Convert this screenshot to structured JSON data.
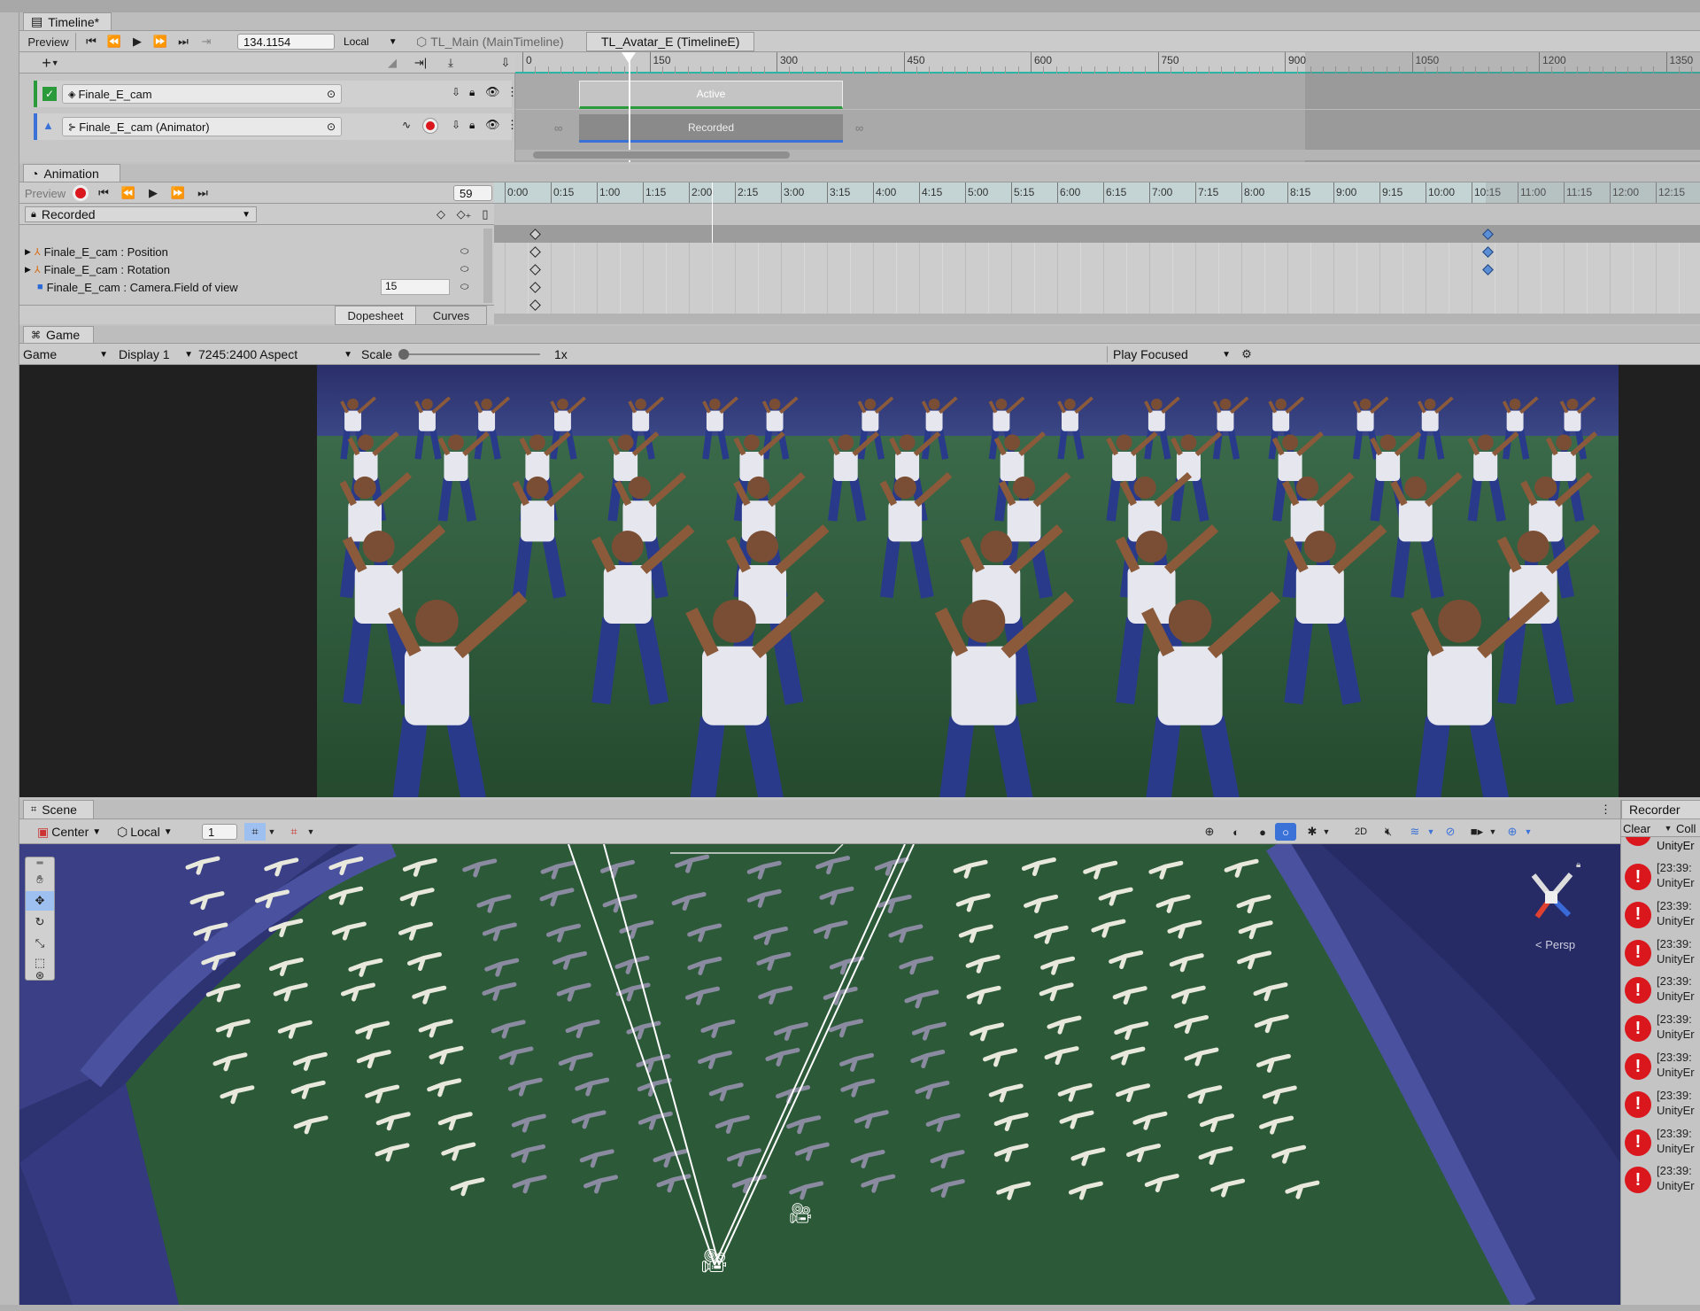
{
  "timeline": {
    "tab_title": "Timeline*",
    "preview_label": "Preview",
    "time_value": "134.1154",
    "local_label": "Local",
    "breadcrumbs": [
      "TL_Main (MainTimeline)",
      "TL_Avatar_E (TimelineE)"
    ],
    "ruler_labels": [
      "0",
      "150",
      "300",
      "450",
      "600",
      "750",
      "900",
      "1050",
      "1200",
      "1350"
    ],
    "tracks": [
      {
        "name": "Finale_E_cam",
        "clip": "Active"
      },
      {
        "name": "Finale_E_cam (Animator)",
        "clip": "Recorded"
      }
    ]
  },
  "animation": {
    "tab_title": "Animation",
    "preview_label": "Preview",
    "frame_value": "59",
    "clip_dropdown": "Recorded",
    "ruler_labels": [
      "0:00",
      "0:15",
      "1:00",
      "1:15",
      "2:00",
      "2:15",
      "3:00",
      "3:15",
      "4:00",
      "4:15",
      "5:00",
      "5:15",
      "6:00",
      "6:15",
      "7:00",
      "7:15",
      "8:00",
      "8:15",
      "9:00",
      "9:15",
      "10:00",
      "10:15",
      "11:00",
      "11:15",
      "12:00",
      "12:15"
    ],
    "properties": [
      {
        "label": "Finale_E_cam : Position",
        "value": ""
      },
      {
        "label": "Finale_E_cam : Rotation",
        "value": ""
      },
      {
        "label": "Finale_E_cam : Camera.Field of view",
        "value": "15"
      }
    ],
    "view_tabs": [
      "Dopesheet",
      "Curves"
    ]
  },
  "game": {
    "tab_title": "Game",
    "mode_dropdown": "Game",
    "display_dropdown": "Display 1",
    "aspect_dropdown": "7245:2400 Aspect",
    "scale_label": "Scale",
    "scale_value": "1x",
    "play_focused": "Play Focused"
  },
  "scene": {
    "tab_title": "Scene",
    "pivot_dropdown": "Center",
    "space_dropdown": "Local",
    "grid_value": "1",
    "mode_2d": "2D",
    "persp_label": "< Persp"
  },
  "recorder": {
    "tab_title": "Recorder",
    "clear_label": "Clear",
    "col_label": "Coll",
    "entries": [
      {
        "time": "[23:39:",
        "source": "UnityEr"
      },
      {
        "time": "[23:39:",
        "source": "UnityEr"
      },
      {
        "time": "[23:39:",
        "source": "UnityEr"
      },
      {
        "time": "[23:39:",
        "source": "UnityEr"
      },
      {
        "time": "[23:39:",
        "source": "UnityEr"
      },
      {
        "time": "[23:39:",
        "source": "UnityEr"
      },
      {
        "time": "[23:39:",
        "source": "UnityEr"
      },
      {
        "time": "[23:39:",
        "source": "UnityEr"
      },
      {
        "time": "[23:39:",
        "source": "UnityEr"
      }
    ],
    "top_entry_source": "UnityEr"
  },
  "colors": {
    "editor_bg": "#c2c2c2",
    "selected_blue": "#3a72d8",
    "record_red": "#d9171d",
    "timeline_teal": "#2bb3a3",
    "grass": "#2e5a3a",
    "track_blue": "#2a2f6e"
  }
}
